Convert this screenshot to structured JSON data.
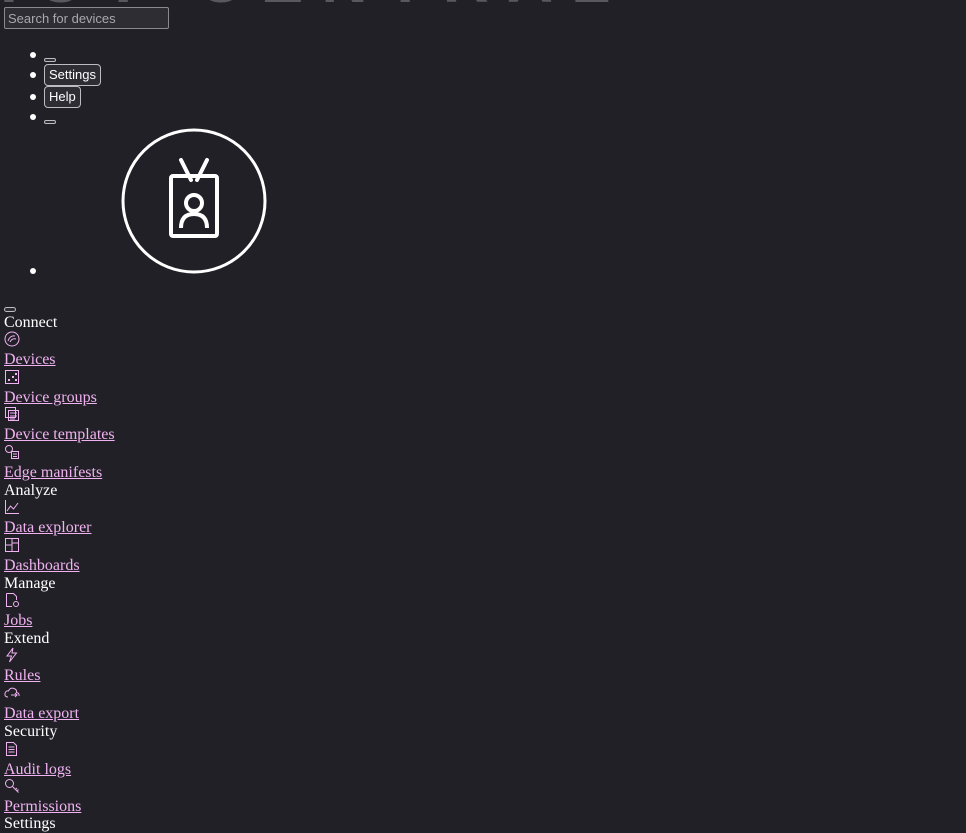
{
  "header": {
    "brand_ghost": "IOT CENTRAL",
    "search": {
      "placeholder": "Search for devices",
      "value": ""
    },
    "settings_label": "Settings",
    "help_label": "Help"
  },
  "colors": {
    "background": "#212027",
    "link": "#f0b2f0",
    "text": "#ffffff",
    "icon_stroke": "#f0b2f0"
  },
  "nav": {
    "sections": [
      {
        "label": "Connect",
        "items": [
          {
            "label": "Devices",
            "icon": "devices-icon"
          },
          {
            "label": "Device groups",
            "icon": "device-groups-icon"
          },
          {
            "label": "Device templates",
            "icon": "device-templates-icon"
          },
          {
            "label": "Edge manifests",
            "icon": "edge-manifests-icon"
          }
        ]
      },
      {
        "label": "Analyze",
        "items": [
          {
            "label": "Data explorer",
            "icon": "data-explorer-icon"
          },
          {
            "label": "Dashboards",
            "icon": "dashboards-icon"
          }
        ]
      },
      {
        "label": "Manage",
        "items": [
          {
            "label": "Jobs",
            "icon": "jobs-icon"
          }
        ]
      },
      {
        "label": "Extend",
        "items": [
          {
            "label": "Rules",
            "icon": "rules-icon"
          },
          {
            "label": "Data export",
            "icon": "data-export-icon"
          }
        ]
      },
      {
        "label": "Security",
        "items": [
          {
            "label": "Audit logs",
            "icon": "audit-logs-icon"
          },
          {
            "label": "Permissions",
            "icon": "permissions-icon"
          }
        ]
      },
      {
        "label": "Settings",
        "items": []
      }
    ]
  }
}
